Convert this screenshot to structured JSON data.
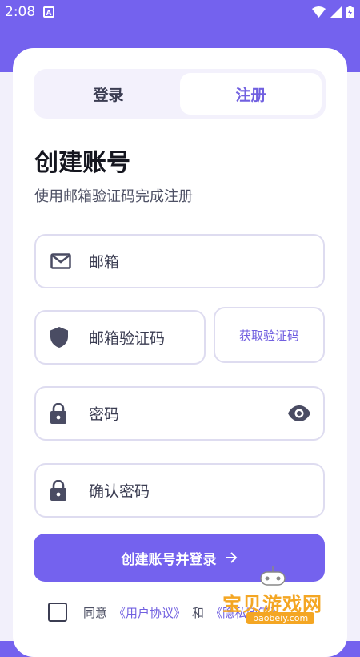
{
  "status_bar": {
    "time": "2:08",
    "notification_icon": "A"
  },
  "tabs": {
    "login": "登录",
    "register": "注册"
  },
  "page": {
    "title": "创建账号",
    "subtitle": "使用邮箱验证码完成注册"
  },
  "fields": {
    "email": "邮箱",
    "code": "邮箱验证码",
    "password": "密码",
    "confirm_password": "确认密码"
  },
  "get_code_label": "获取验证码",
  "submit_label": "创建账号并登录",
  "agreement": {
    "prefix": "同意",
    "user_agreement": "《用户协议》",
    "and": "和",
    "privacy_policy": "《隐私政策》"
  },
  "watermark": {
    "title": "宝贝游戏网",
    "url": "baobeiy.com"
  },
  "colors": {
    "accent": "#7462ee",
    "link": "#7160e0",
    "watermark": "#f4a623"
  },
  "icons": [
    "mail-icon",
    "shield-icon",
    "lock-icon",
    "eye-icon",
    "arrow-right-icon",
    "wifi-icon",
    "signal-icon",
    "battery-icon"
  ]
}
